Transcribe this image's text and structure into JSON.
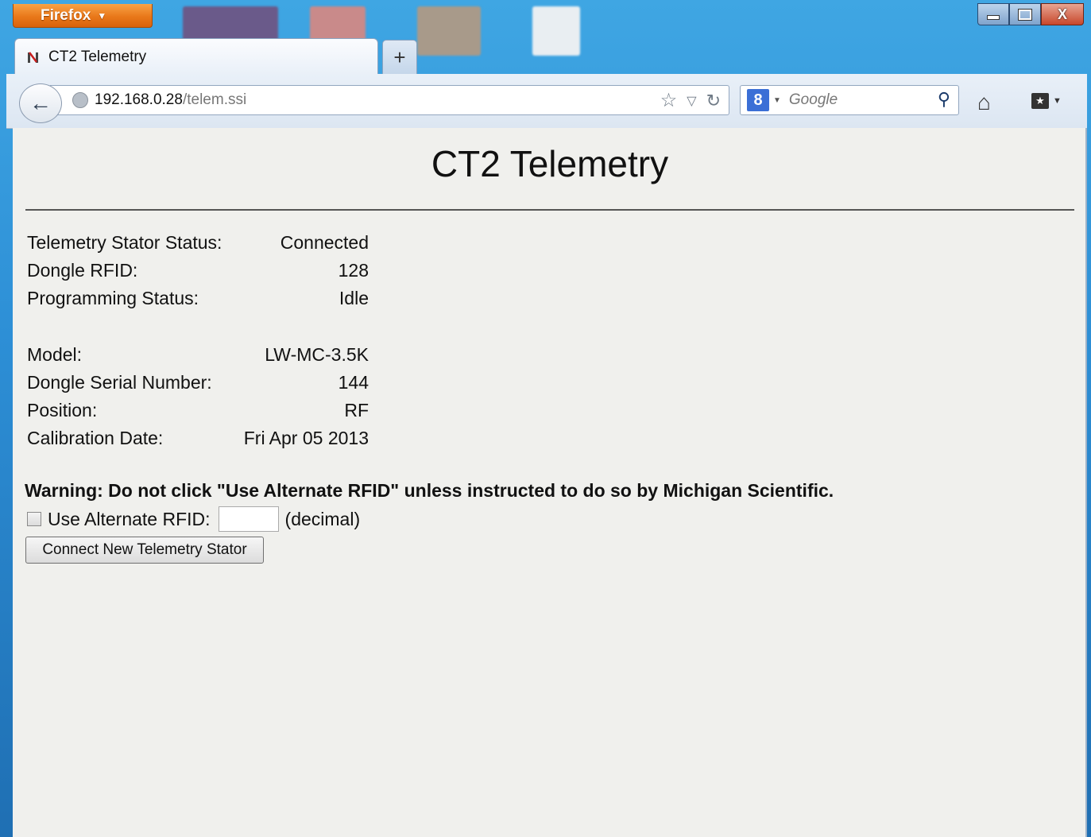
{
  "browser": {
    "menu_button": "Firefox",
    "tab_title": "CT2 Telemetry",
    "new_tab": "+",
    "url_host": "192.168.0.28",
    "url_path": "/telem.ssi",
    "search_placeholder": "Google",
    "window_close": "X"
  },
  "page": {
    "title": "CT2 Telemetry",
    "status_rows": [
      {
        "label": "Telemetry Stator Status:",
        "value": "Connected"
      },
      {
        "label": "Dongle RFID:",
        "value": "128"
      },
      {
        "label": "Programming Status:",
        "value": "Idle"
      }
    ],
    "info_rows": [
      {
        "label": "Model:",
        "value": "LW-MC-3.5K"
      },
      {
        "label": "Dongle Serial Number:",
        "value": "144"
      },
      {
        "label": "Position:",
        "value": "RF"
      },
      {
        "label": "Calibration Date:",
        "value": "Fri Apr 05 2013"
      }
    ],
    "warning": "Warning: Do not click \"Use Alternate RFID\" unless instructed to do so by Michigan Scientific.",
    "alt_rfid_label": "Use Alternate RFID:",
    "alt_rfid_checked": false,
    "alt_rfid_value": "",
    "decimal_note": "(decimal)",
    "connect_button": "Connect New Telemetry Stator"
  }
}
